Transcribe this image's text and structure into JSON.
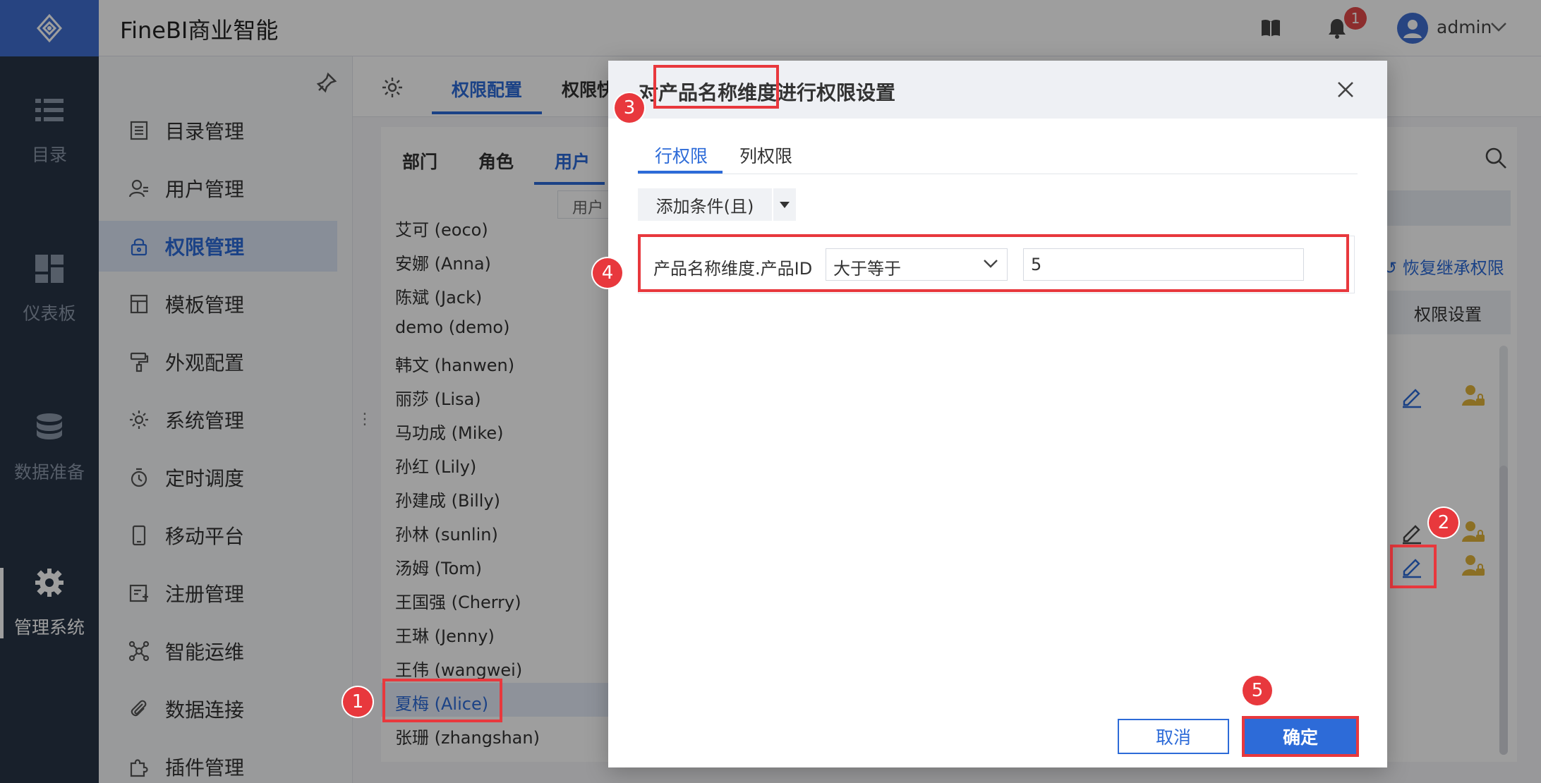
{
  "app": {
    "title": "FineBI商业智能",
    "notification_count": "1",
    "user": "admin"
  },
  "rail": [
    {
      "label": "目录",
      "icon": "list-icon"
    },
    {
      "label": "仪表板",
      "icon": "dashboard-icon"
    },
    {
      "label": "数据准备",
      "icon": "database-icon"
    },
    {
      "label": "管理系统",
      "icon": "gear-icon",
      "active": true
    }
  ],
  "menu": [
    {
      "label": "目录管理"
    },
    {
      "label": "用户管理"
    },
    {
      "label": "权限管理",
      "active": true
    },
    {
      "label": "模板管理"
    },
    {
      "label": "外观配置"
    },
    {
      "label": "系统管理"
    },
    {
      "label": "定时调度"
    },
    {
      "label": "移动平台"
    },
    {
      "label": "注册管理"
    },
    {
      "label": "智能运维"
    },
    {
      "label": "数据连接"
    },
    {
      "label": "插件管理"
    }
  ],
  "content": {
    "tabs": [
      "权限配置",
      "权限快"
    ],
    "subtabs": [
      "部门",
      "角色",
      "用户"
    ],
    "search_label": "用户",
    "restore_label": "恢复继承权限",
    "perm_header": "权限设置",
    "users": [
      "艾可 (eoco)",
      "安娜 (Anna)",
      "陈斌 (Jack)",
      "demo (demo)",
      "韩文 (hanwen)",
      "丽莎 (Lisa)",
      "马功成 (Mike)",
      "孙红 (Lily)",
      "孙建成 (Billy)",
      "孙林 (sunlin)",
      "汤姆 (Tom)",
      "王国强 (Cherry)",
      "王琳 (Jenny)",
      "王伟 (wangwei)",
      "夏梅 (Alice)",
      "张珊 (zhangshan)"
    ],
    "selected_user": "夏梅 (Alice)"
  },
  "dialog": {
    "title": "对产品名称维度进行权限设置",
    "tabs": [
      "行权限",
      "列权限"
    ],
    "add_condition": "添加条件(且)",
    "condition": {
      "field": "产品名称维度.产品ID",
      "operator": "大于等于",
      "value": "5"
    },
    "cancel": "取消",
    "ok": "确定"
  },
  "annotations": [
    "1",
    "2",
    "3",
    "4",
    "5"
  ],
  "colors": {
    "accent": "#2d6bd8",
    "annotation": "#e8383d",
    "rail": "#283446"
  }
}
